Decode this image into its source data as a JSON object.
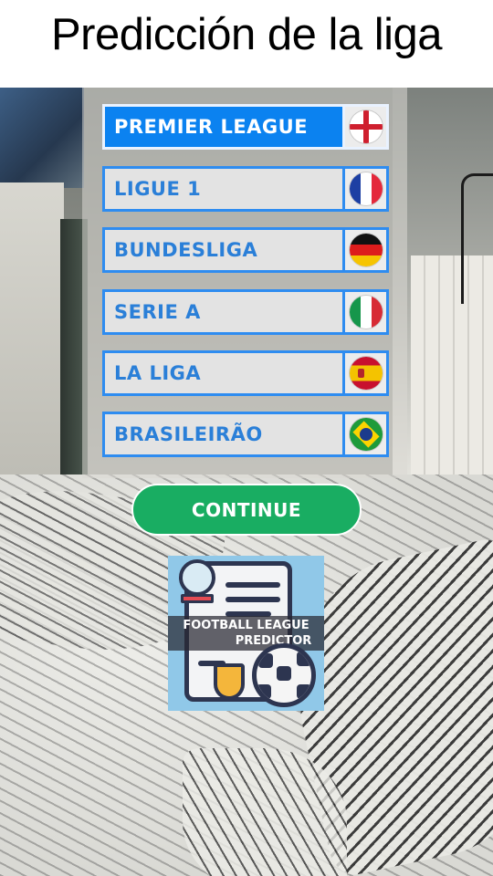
{
  "header": {
    "title": "Predicción de la liga"
  },
  "leagues": [
    {
      "label": "PREMIER LEAGUE",
      "flag": "england-flag-icon",
      "selected": true
    },
    {
      "label": "LIGUE 1",
      "flag": "france-flag-icon",
      "selected": false
    },
    {
      "label": "BUNDESLIGA",
      "flag": "germany-flag-icon",
      "selected": false
    },
    {
      "label": "SERIE A",
      "flag": "italy-flag-icon",
      "selected": false
    },
    {
      "label": "LA LIGA",
      "flag": "spain-flag-icon",
      "selected": false
    },
    {
      "label": "BRASILEIRÃO",
      "flag": "brazil-flag-icon",
      "selected": false
    }
  ],
  "continue_button": {
    "label": "CONTINUE"
  },
  "logo": {
    "line1": "FOOTBALL LEAGUE",
    "line2": "PREDICTOR"
  },
  "colors": {
    "selected_bg": "#0b82f0",
    "item_border": "#2e8cf0",
    "item_text": "#2a7fd8",
    "continue_bg": "#19ad62",
    "title_bg": "#ffffff"
  }
}
